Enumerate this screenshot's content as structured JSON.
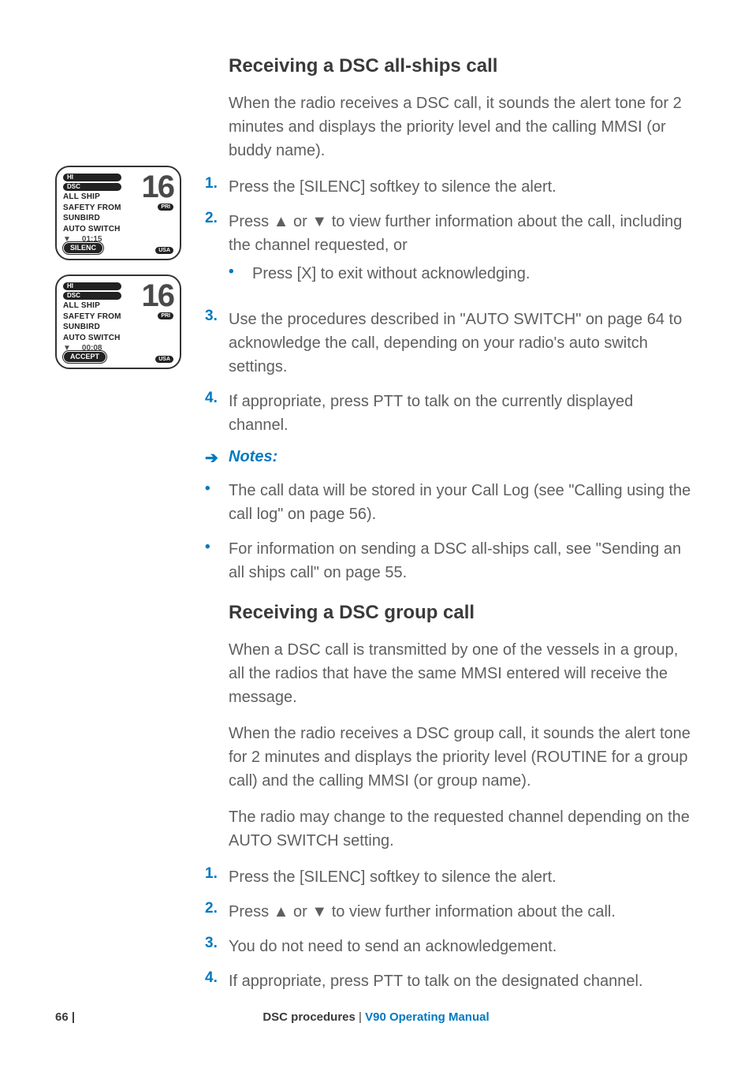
{
  "heading1": "Receiving a DSC all-ships call",
  "intro1": "When the radio receives a DSC call, it sounds the alert tone for 2 minutes and displays the priority level and the calling MMSI (or buddy name).",
  "steps1": [
    "Press the [SILENC] softkey to silence the alert.",
    "Press ▲ or ▼ to view further information about the call, including the channel requested, or",
    "Use the procedures described in \"AUTO SWITCH\" on page 64 to acknowledge the call, depending on your radio's auto switch settings.",
    "If appropriate, press PTT to talk on the currently displayed channel."
  ],
  "sub_bullet1": "Press [X] to exit without acknowledging.",
  "notes_label": "Notes:",
  "notes": [
    "The call data will be stored in your Call Log (see \"Calling using the call log\" on page 56).",
    "For information on sending a DSC all-ships call, see \"Sending an all ships call\" on page 55."
  ],
  "heading2": "Receiving a DSC group call",
  "intro2a": "When a DSC call is transmitted by one of the vessels in a group, all the radios that have the same MMSI entered will receive the message.",
  "intro2b": "When the radio receives a DSC group call, it sounds the alert tone for 2 minutes and displays the priority level (ROUTINE for a group call) and the calling MMSI (or group name).",
  "intro2c": "The radio may change to the requested channel depending on the AUTO SWITCH setting.",
  "steps2": [
    "Press the [SILENC] softkey to silence the alert.",
    "Press ▲ or ▼ to view further information about the call.",
    "You do not need to send an acknowledgement.",
    "If appropriate, press PTT to talk on the designated channel."
  ],
  "lcd": {
    "hi": "HI",
    "dsc": "DSC",
    "channel": "16",
    "pri": "PRI",
    "line1": "ALL SHIP",
    "line2": "SAFETY FROM",
    "line3": "SUNBIRD",
    "line4": "AUTO SWITCH",
    "region": "USA",
    "screen1": {
      "time": "01:15",
      "softkey": "SILENC"
    },
    "screen2": {
      "time": "00:08",
      "softkey": "ACCEPT"
    }
  },
  "footer": {
    "page": "66 |",
    "section": "DSC procedures",
    "sep": " | ",
    "manual": "V90 Operating Manual"
  }
}
